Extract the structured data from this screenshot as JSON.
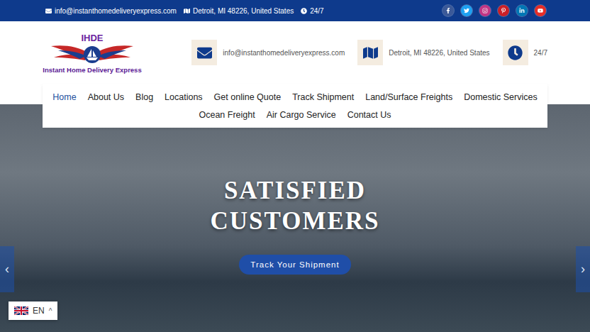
{
  "top_bar": {
    "contacts": [
      {
        "kind": "email",
        "text": "info@instanthomedeliveryexpress.com"
      },
      {
        "kind": "map",
        "text": "Detroit, MI 48226, United States"
      },
      {
        "kind": "clock",
        "text": "24/7"
      }
    ],
    "social": [
      {
        "kind": "facebook",
        "color": "#3b5998"
      },
      {
        "kind": "twitter",
        "color": "#1da1f2"
      },
      {
        "kind": "instagram",
        "color": "#c13584"
      },
      {
        "kind": "pinterest",
        "color": "#cb2027"
      },
      {
        "kind": "linkedin",
        "color": "#0077b5"
      },
      {
        "kind": "youtube",
        "color": "#e52d27"
      }
    ]
  },
  "logo": {
    "initials": "IHDE",
    "name": "Instant Home Delivery Express"
  },
  "header_info": [
    {
      "kind": "email",
      "text": "info@instanthomedeliveryexpress.com"
    },
    {
      "kind": "map",
      "text": "Detroit, MI 48226, United States"
    },
    {
      "kind": "clock",
      "text": "24/7"
    }
  ],
  "nav": {
    "rows": [
      {
        "items": [
          {
            "label": "Home",
            "selected": true
          },
          {
            "label": "About Us",
            "selected": false
          },
          {
            "label": "Blog",
            "selected": false
          },
          {
            "label": "Locations",
            "selected": false
          },
          {
            "label": "Get online Quote",
            "selected": false
          },
          {
            "label": "Track Shipment",
            "selected": false
          },
          {
            "label": "Land/Surface Freights",
            "selected": false
          },
          {
            "label": "Domestic Services",
            "selected": false
          }
        ]
      },
      {
        "items": [
          {
            "label": "Ocean Freight",
            "selected": false
          },
          {
            "label": "Air Cargo Service",
            "selected": false
          },
          {
            "label": "Contact Us",
            "selected": false
          }
        ]
      }
    ]
  },
  "hero": {
    "title_lines": [
      "SATISFIED",
      "CUSTOMERS"
    ],
    "button": "Track Your Shipment",
    "prev": "‹",
    "next": "›"
  },
  "language": {
    "code": "EN",
    "arrow": "^"
  }
}
